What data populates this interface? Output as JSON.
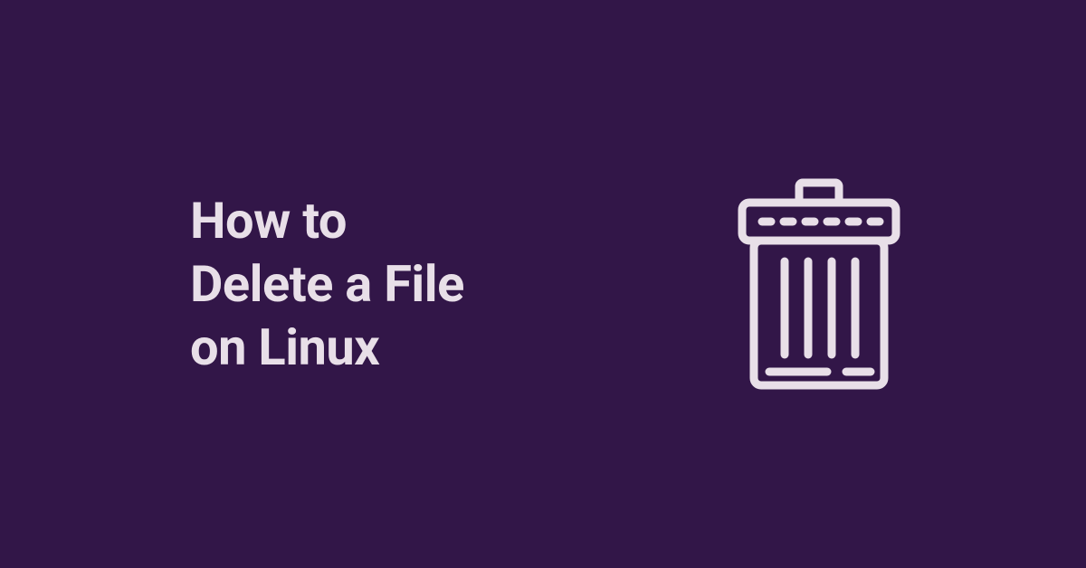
{
  "title": "How to\nDelete a File\non Linux",
  "colors": {
    "background": "#321648",
    "foreground": "#e8dfe8"
  },
  "icon": {
    "name": "trash-icon"
  }
}
